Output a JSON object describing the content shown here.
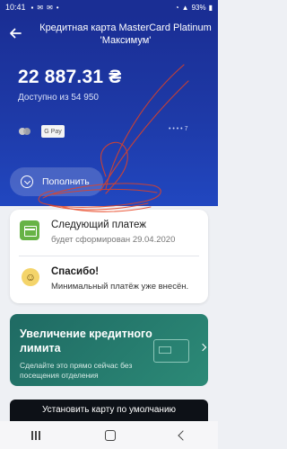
{
  "status_bar": {
    "time": "10:41",
    "battery": "93%"
  },
  "header": {
    "card_title": "Кредитная карта MasterCard Platinum 'Максимум'",
    "balance": "22 887.31 ₴",
    "available": "Доступно из 54 950",
    "gpay_label": "G Pay",
    "card_dots": "• • • • 7",
    "topup_label": "Пополнить"
  },
  "info_card": {
    "next_payment_title": "Следующий платеж",
    "next_payment_sub": "будет сформирован 29.04.2020",
    "thanks_title": "Спасибо!",
    "thanks_sub": "Минимальный платёж уже внесён."
  },
  "promo": {
    "title": "Увеличение кредитного лимита",
    "subtitle": "Сделайте это прямо сейчас без посещения отделения"
  },
  "default_card": {
    "label": "Установить карту по умолчанию"
  },
  "colors": {
    "header_blue": "#1a2e94",
    "promo_green": "#2c8a77",
    "payment_icon_green": "#67b346",
    "scribble_red": "#e8421f"
  }
}
